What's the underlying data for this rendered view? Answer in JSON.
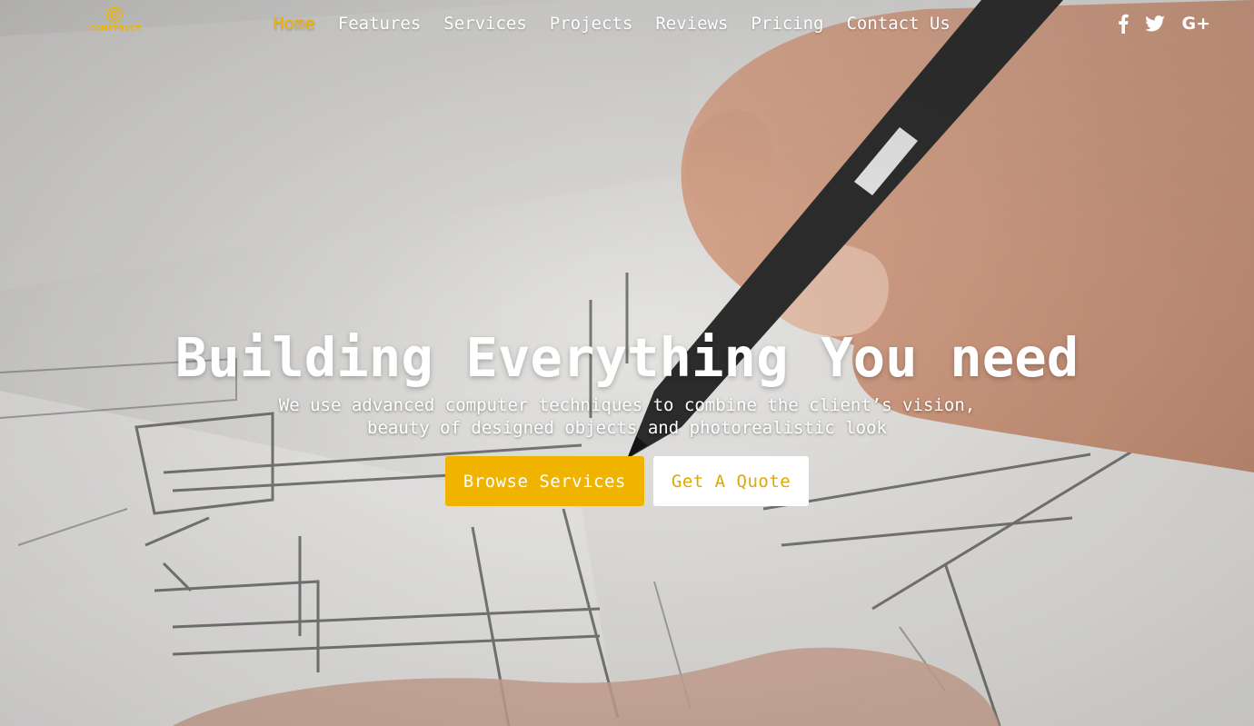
{
  "brand": {
    "logo_text": "CONSTRUCT",
    "accent_color": "#f0b400"
  },
  "nav": {
    "items": [
      {
        "label": "Home",
        "active": true
      },
      {
        "label": "Features",
        "active": false
      },
      {
        "label": "Services",
        "active": false
      },
      {
        "label": "Projects",
        "active": false
      },
      {
        "label": "Reviews",
        "active": false
      },
      {
        "label": "Pricing",
        "active": false
      },
      {
        "label": "Contact Us",
        "active": false
      }
    ]
  },
  "social": {
    "icons": [
      "facebook-icon",
      "twitter-icon",
      "google-plus-icon"
    ],
    "gplus_glyph": "G+"
  },
  "hero": {
    "headline": "Building Everything You need",
    "subtitle": "We use advanced computer techniques to combine the client’s vision, beauty of designed objects and photorealistic look",
    "primary_button": "Browse Services",
    "secondary_button": "Get A Quote"
  }
}
